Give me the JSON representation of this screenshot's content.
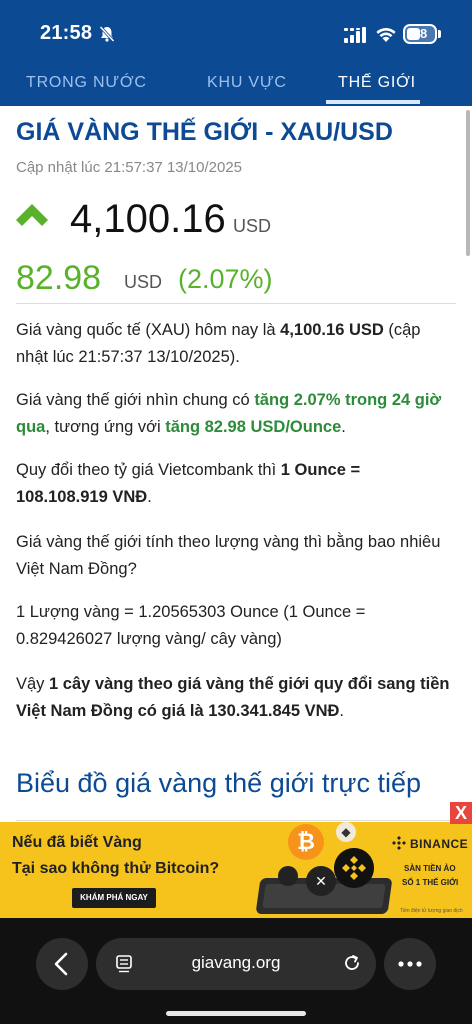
{
  "status_bar": {
    "time": "21:58",
    "battery": "28"
  },
  "tabs": [
    {
      "label": "TRONG NƯỚC"
    },
    {
      "label": "KHU VỰC"
    },
    {
      "label": "THẾ GIỚI"
    }
  ],
  "header": {
    "title": "GIÁ VÀNG THẾ GIỚI - XAU/USD",
    "updated": "Cập nhật lúc 21:57:37 13/10/2025"
  },
  "price": {
    "value": "4,100.16",
    "currency": "USD",
    "change": "82.98",
    "change_currency": "USD",
    "change_pct": "(2.07%)"
  },
  "article": {
    "p1_a": "Giá vàng quốc tế (XAU) hôm nay là ",
    "p1_b": "4,100.16 USD",
    "p1_c": " (cập nhật lúc 21:57:37 13/10/2025).",
    "p2_a": "Giá vàng thế giới nhìn chung có ",
    "p2_b": "tăng 2.07% trong 24 giờ qua",
    "p2_c": ", tương ứng với ",
    "p2_d": "tăng 82.98 USD/Ounce",
    "p2_e": ".",
    "p3_a": "Quy đổi theo tỷ giá Vietcombank thì ",
    "p3_b": "1 Ounce = 108.108.919 VNĐ",
    "p3_c": ".",
    "p4": "Giá vàng thế giới tính theo lượng vàng thì bằng bao nhiêu Việt Nam Đồng?",
    "p5": "1 Lượng vàng = 1.20565303 Ounce (1 Ounce = 0.829426027 lượng vàng/ cây vàng)",
    "p6_a": "Vậy ",
    "p6_b": "1 cây vàng theo giá vàng thế giới quy đổi sang tiền Việt Nam Đồng có giá là 130.341.845 VNĐ",
    "p6_c": "."
  },
  "section": {
    "heading": "Biểu đồ giá vàng thế giới trực tiếp"
  },
  "ad": {
    "close": "X",
    "line1": "Nếu đã biết Vàng",
    "line2": "Tại sao không thử Bitcoin?",
    "button": "KHÁM PHÁ NGAY",
    "brand": "BINANCE",
    "right1": "SÀN TIỀN ẢO",
    "right2": "SỐ 1 THẾ GIỚI",
    "fine_print": "Tiền điện tử lượng giao dịch",
    "btc_symbol": "₿",
    "eth_symbol": "◆",
    "xrp_symbol": "✕"
  },
  "browser": {
    "url": "giavang.org"
  },
  "colors": {
    "header_bg": "#0d4a94",
    "up_green": "#59b22a",
    "ad_yellow": "#f6c21c"
  },
  "icons": [
    "bell-slash-icon",
    "signal-icon",
    "wifi-icon",
    "battery-icon",
    "up-arrow-icon",
    "back-icon",
    "tabs-icon",
    "reload-icon",
    "more-icon"
  ]
}
